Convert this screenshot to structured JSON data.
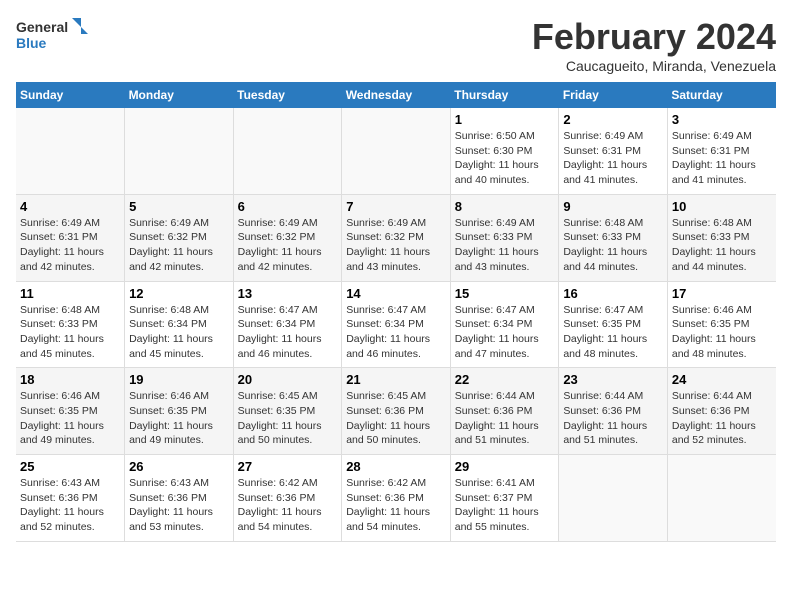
{
  "header": {
    "logo_general": "General",
    "logo_blue": "Blue",
    "main_title": "February 2024",
    "subtitle": "Caucagueito, Miranda, Venezuela"
  },
  "days_of_week": [
    "Sunday",
    "Monday",
    "Tuesday",
    "Wednesday",
    "Thursday",
    "Friday",
    "Saturday"
  ],
  "weeks": [
    {
      "days": [
        {
          "date": "",
          "info": "",
          "empty": true
        },
        {
          "date": "",
          "info": "",
          "empty": true
        },
        {
          "date": "",
          "info": "",
          "empty": true
        },
        {
          "date": "",
          "info": "",
          "empty": true
        },
        {
          "date": "1",
          "info": "Sunrise: 6:50 AM\nSunset: 6:30 PM\nDaylight: 11 hours\nand 40 minutes."
        },
        {
          "date": "2",
          "info": "Sunrise: 6:49 AM\nSunset: 6:31 PM\nDaylight: 11 hours\nand 41 minutes."
        },
        {
          "date": "3",
          "info": "Sunrise: 6:49 AM\nSunset: 6:31 PM\nDaylight: 11 hours\nand 41 minutes."
        }
      ]
    },
    {
      "days": [
        {
          "date": "4",
          "info": "Sunrise: 6:49 AM\nSunset: 6:31 PM\nDaylight: 11 hours\nand 42 minutes."
        },
        {
          "date": "5",
          "info": "Sunrise: 6:49 AM\nSunset: 6:32 PM\nDaylight: 11 hours\nand 42 minutes."
        },
        {
          "date": "6",
          "info": "Sunrise: 6:49 AM\nSunset: 6:32 PM\nDaylight: 11 hours\nand 42 minutes."
        },
        {
          "date": "7",
          "info": "Sunrise: 6:49 AM\nSunset: 6:32 PM\nDaylight: 11 hours\nand 43 minutes."
        },
        {
          "date": "8",
          "info": "Sunrise: 6:49 AM\nSunset: 6:33 PM\nDaylight: 11 hours\nand 43 minutes."
        },
        {
          "date": "9",
          "info": "Sunrise: 6:48 AM\nSunset: 6:33 PM\nDaylight: 11 hours\nand 44 minutes."
        },
        {
          "date": "10",
          "info": "Sunrise: 6:48 AM\nSunset: 6:33 PM\nDaylight: 11 hours\nand 44 minutes."
        }
      ]
    },
    {
      "days": [
        {
          "date": "11",
          "info": "Sunrise: 6:48 AM\nSunset: 6:33 PM\nDaylight: 11 hours\nand 45 minutes."
        },
        {
          "date": "12",
          "info": "Sunrise: 6:48 AM\nSunset: 6:34 PM\nDaylight: 11 hours\nand 45 minutes."
        },
        {
          "date": "13",
          "info": "Sunrise: 6:47 AM\nSunset: 6:34 PM\nDaylight: 11 hours\nand 46 minutes."
        },
        {
          "date": "14",
          "info": "Sunrise: 6:47 AM\nSunset: 6:34 PM\nDaylight: 11 hours\nand 46 minutes."
        },
        {
          "date": "15",
          "info": "Sunrise: 6:47 AM\nSunset: 6:34 PM\nDaylight: 11 hours\nand 47 minutes."
        },
        {
          "date": "16",
          "info": "Sunrise: 6:47 AM\nSunset: 6:35 PM\nDaylight: 11 hours\nand 48 minutes."
        },
        {
          "date": "17",
          "info": "Sunrise: 6:46 AM\nSunset: 6:35 PM\nDaylight: 11 hours\nand 48 minutes."
        }
      ]
    },
    {
      "days": [
        {
          "date": "18",
          "info": "Sunrise: 6:46 AM\nSunset: 6:35 PM\nDaylight: 11 hours\nand 49 minutes."
        },
        {
          "date": "19",
          "info": "Sunrise: 6:46 AM\nSunset: 6:35 PM\nDaylight: 11 hours\nand 49 minutes."
        },
        {
          "date": "20",
          "info": "Sunrise: 6:45 AM\nSunset: 6:35 PM\nDaylight: 11 hours\nand 50 minutes."
        },
        {
          "date": "21",
          "info": "Sunrise: 6:45 AM\nSunset: 6:36 PM\nDaylight: 11 hours\nand 50 minutes."
        },
        {
          "date": "22",
          "info": "Sunrise: 6:44 AM\nSunset: 6:36 PM\nDaylight: 11 hours\nand 51 minutes."
        },
        {
          "date": "23",
          "info": "Sunrise: 6:44 AM\nSunset: 6:36 PM\nDaylight: 11 hours\nand 51 minutes."
        },
        {
          "date": "24",
          "info": "Sunrise: 6:44 AM\nSunset: 6:36 PM\nDaylight: 11 hours\nand 52 minutes."
        }
      ]
    },
    {
      "days": [
        {
          "date": "25",
          "info": "Sunrise: 6:43 AM\nSunset: 6:36 PM\nDaylight: 11 hours\nand 52 minutes."
        },
        {
          "date": "26",
          "info": "Sunrise: 6:43 AM\nSunset: 6:36 PM\nDaylight: 11 hours\nand 53 minutes."
        },
        {
          "date": "27",
          "info": "Sunrise: 6:42 AM\nSunset: 6:36 PM\nDaylight: 11 hours\nand 54 minutes."
        },
        {
          "date": "28",
          "info": "Sunrise: 6:42 AM\nSunset: 6:36 PM\nDaylight: 11 hours\nand 54 minutes."
        },
        {
          "date": "29",
          "info": "Sunrise: 6:41 AM\nSunset: 6:37 PM\nDaylight: 11 hours\nand 55 minutes."
        },
        {
          "date": "",
          "info": "",
          "empty": true
        },
        {
          "date": "",
          "info": "",
          "empty": true
        }
      ]
    }
  ]
}
